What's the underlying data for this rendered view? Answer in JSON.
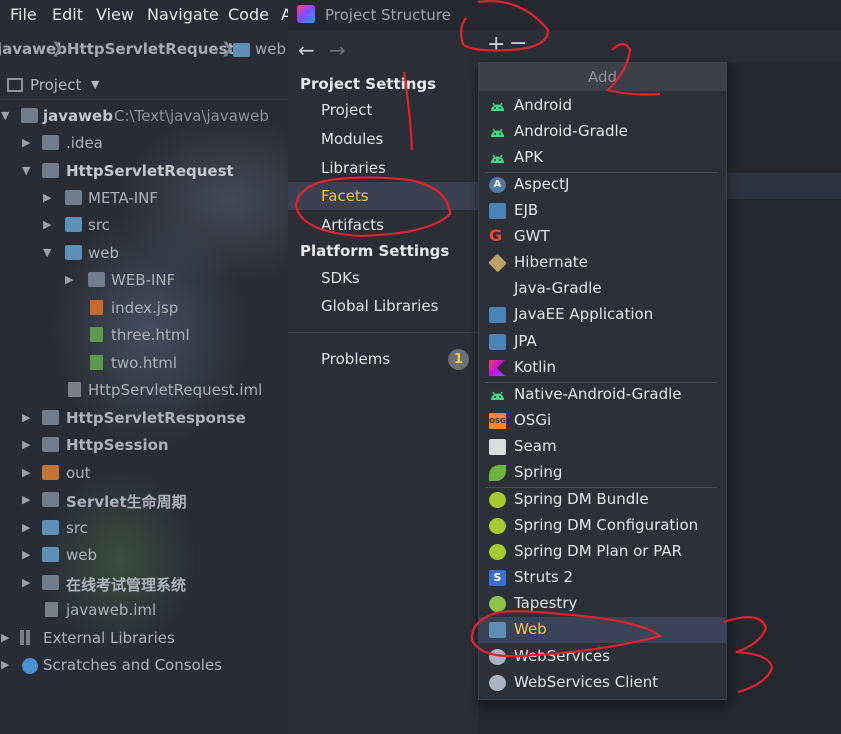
{
  "ide": {
    "menu": [
      "File",
      "Edit",
      "View",
      "Navigate",
      "Code",
      "A"
    ],
    "breadcrumb": {
      "root": "javaweb",
      "module": "HttpServletRequest",
      "folder": "web"
    },
    "project_label": "Project",
    "tree": [
      {
        "label": "javaweb",
        "extra": "C:\\Text\\java\\javaweb"
      },
      {
        "label": ".idea"
      },
      {
        "label": "HttpServletRequest"
      },
      {
        "label": "META-INF"
      },
      {
        "label": "src"
      },
      {
        "label": "web"
      },
      {
        "label": "WEB-INF"
      },
      {
        "label": "index.jsp"
      },
      {
        "label": "three.html"
      },
      {
        "label": "two.html"
      },
      {
        "label": "HttpServletRequest.iml"
      },
      {
        "label": "HttpServletResponse"
      },
      {
        "label": "HttpSession"
      },
      {
        "label": "out"
      },
      {
        "label": "Servlet生命周期"
      },
      {
        "label": "src"
      },
      {
        "label": "web"
      },
      {
        "label": "在线考试管理系统"
      },
      {
        "label": "javaweb.iml"
      },
      {
        "label": "External Libraries"
      },
      {
        "label": "Scratches and Consoles"
      }
    ]
  },
  "dialog": {
    "title": "Project Structure",
    "back_arrow": "←",
    "forward_arrow": "→",
    "project_settings_header": "Project Settings",
    "project_settings": [
      "Project",
      "Modules",
      "Libraries",
      "Facets",
      "Artifacts"
    ],
    "selected_item": "Facets",
    "platform_settings_header": "Platform Settings",
    "platform_settings": [
      "SDKs",
      "Global Libraries"
    ],
    "problems_label": "Problems",
    "problems_count": "1",
    "add_symbol": "+",
    "remove_symbol": "−",
    "right_fragment": ")"
  },
  "popup": {
    "title": "Add",
    "selected": "Web",
    "items": [
      {
        "label": "Android",
        "icon": "android-icon",
        "color": "#3ddc84"
      },
      {
        "label": "Android-Gradle",
        "icon": "android-icon",
        "color": "#3ddc84"
      },
      {
        "label": "APK",
        "icon": "android-icon",
        "color": "#3ddc84"
      },
      {
        "label": "AspectJ",
        "icon": "aspectj-icon",
        "color": "#5e8fc8"
      },
      {
        "label": "EJB",
        "icon": "ejb-icon",
        "color": "#4a84b9"
      },
      {
        "label": "GWT",
        "icon": "google-icon",
        "color": "#ea4335"
      },
      {
        "label": "Hibernate",
        "icon": "hibernate-icon",
        "color": "#bca068"
      },
      {
        "label": "Java-Gradle",
        "icon": "",
        "color": ""
      },
      {
        "label": "JavaEE Application",
        "icon": "javaee-icon",
        "color": "#4a84b9"
      },
      {
        "label": "JPA",
        "icon": "jpa-icon",
        "color": "#4a84b9"
      },
      {
        "label": "Kotlin",
        "icon": "kotlin-icon",
        "color": "#e44857"
      },
      {
        "label": "Native-Android-Gradle",
        "icon": "android-icon",
        "color": "#3ddc84"
      },
      {
        "label": "OSGi",
        "icon": "osgi-icon",
        "color": "#f08a24"
      },
      {
        "label": "Seam",
        "icon": "seam-icon",
        "color": "#dcdcdc"
      },
      {
        "label": "Spring",
        "icon": "spring-leaf-icon",
        "color": "#6db33f"
      },
      {
        "label": "Spring DM Bundle",
        "icon": "spring-dm-icon",
        "color": "#a8c832"
      },
      {
        "label": "Spring DM Configuration",
        "icon": "spring-dm-icon",
        "color": "#a8c832"
      },
      {
        "label": "Spring DM Plan or PAR",
        "icon": "spring-dm-icon",
        "color": "#a8c832"
      },
      {
        "label": "Struts 2",
        "icon": "struts-icon",
        "color": "#3c6fd1"
      },
      {
        "label": "Tapestry",
        "icon": "tapestry-icon",
        "color": "#8fc24a"
      },
      {
        "label": "Web",
        "icon": "web-icon",
        "color": "#5e8fb7"
      },
      {
        "label": "WebServices",
        "icon": "globe-icon",
        "color": "#aab3c2"
      },
      {
        "label": "WebServices Client",
        "icon": "globe-icon",
        "color": "#aab3c2"
      }
    ]
  },
  "annotations": {
    "color": "#e0242d"
  }
}
